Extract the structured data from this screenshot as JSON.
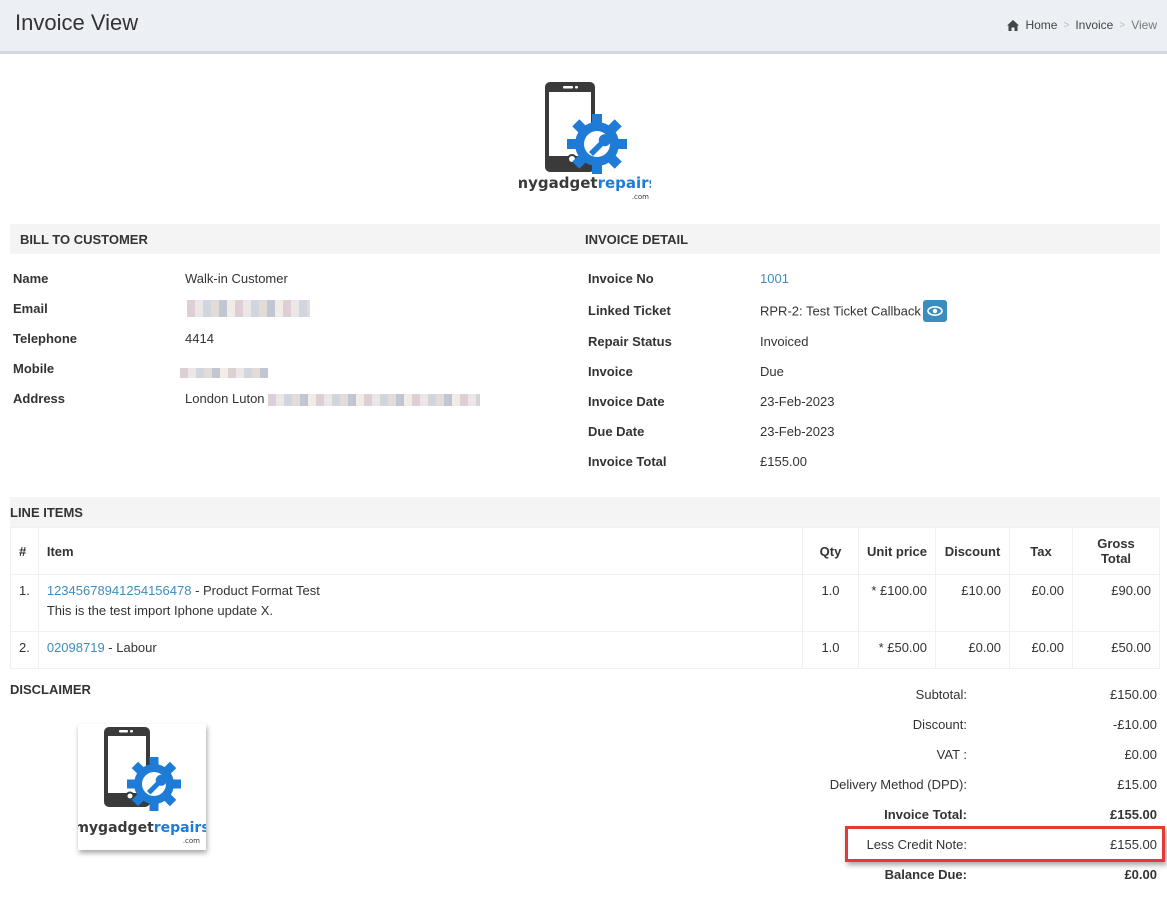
{
  "header": {
    "title": "Invoice View",
    "breadcrumb": [
      "Home",
      "Invoice",
      "View"
    ]
  },
  "brand": {
    "name_dark": "mygadget",
    "name_blue": "repairs",
    "suffix": ".com",
    "colors": {
      "dark": "#3a3a3a",
      "blue": "#1e7bd6"
    }
  },
  "bill_to": {
    "heading": "BILL TO CUSTOMER",
    "rows": [
      {
        "label": "Name",
        "value": "Walk-in Customer"
      },
      {
        "label": "Email",
        "value": ""
      },
      {
        "label": "Telephone",
        "value": "4414"
      },
      {
        "label": "Mobile",
        "value": ""
      },
      {
        "label": "Address",
        "value": "London Luton"
      }
    ]
  },
  "invoice_detail": {
    "heading": "INVOICE DETAIL",
    "rows": [
      {
        "label": "Invoice No",
        "value": "1001"
      },
      {
        "label": "Linked Ticket",
        "value": "RPR-2: Test Ticket Callback"
      },
      {
        "label": "Repair Status",
        "value": "Invoiced"
      },
      {
        "label": "Invoice",
        "value": "Due"
      },
      {
        "label": "Invoice Date",
        "value": "23-Feb-2023"
      },
      {
        "label": "Due Date",
        "value": "23-Feb-2023"
      },
      {
        "label": "Invoice Total",
        "value": "£155.00"
      }
    ]
  },
  "line_items": {
    "heading": "LINE ITEMS",
    "columns": [
      "#",
      "Item",
      "Qty",
      "Unit price",
      "Discount",
      "Tax",
      "Gross Total"
    ],
    "rows": [
      {
        "num": "1.",
        "code": "12345678941254156478",
        "name": " - Product Format Test",
        "desc": "This is the test import Iphone update X.",
        "qty": "1.0",
        "unit_price": "* £100.00",
        "discount": "£10.00",
        "tax": "£0.00",
        "gross": "£90.00"
      },
      {
        "num": "2.",
        "code": "02098719",
        "name": " - Labour",
        "desc": "",
        "qty": "1.0",
        "unit_price": "* £50.00",
        "discount": "£0.00",
        "tax": "£0.00",
        "gross": "£50.00"
      }
    ]
  },
  "disclaimer": {
    "heading": "DISCLAIMER"
  },
  "totals": [
    {
      "label": "Subtotal:",
      "value": "£150.00"
    },
    {
      "label": "Discount:",
      "value": "-£10.00"
    },
    {
      "label": "VAT :",
      "value": "£0.00"
    },
    {
      "label": "Delivery Method (DPD):",
      "value": "£15.00"
    },
    {
      "label": "Invoice Total:",
      "value": "£155.00"
    },
    {
      "label": "Less Credit Note:",
      "value": "£155.00"
    },
    {
      "label": "Balance Due:",
      "value": "£0.00"
    }
  ],
  "colors": {
    "link": "#3c8dbc",
    "highlight": "#e53935",
    "header_bg": "#ecf0f5",
    "section_bg": "#f4f4f4"
  }
}
